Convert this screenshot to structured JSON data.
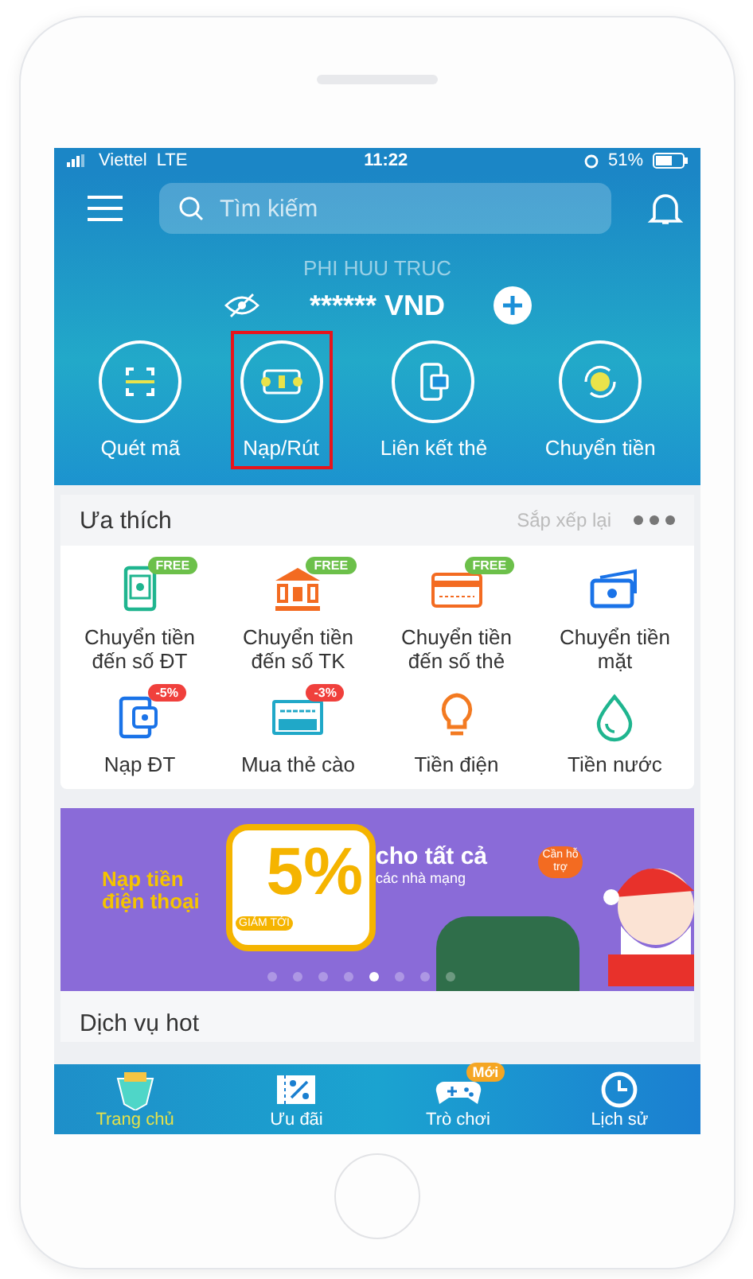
{
  "status_bar": {
    "carrier": "Viettel",
    "network": "LTE",
    "time": "11:22",
    "battery": "51%"
  },
  "header": {
    "search": {
      "placeholder": "Tìm kiếm"
    },
    "account_name": "PHI HUU TRUC",
    "balance": "****** VND"
  },
  "actions": [
    {
      "kind": "scan",
      "label": "Quét mã",
      "highlighted": false
    },
    {
      "kind": "topup",
      "label": "Nạp/Rút",
      "highlighted": true
    },
    {
      "kind": "link",
      "label": "Liên kết thẻ",
      "highlighted": false
    },
    {
      "kind": "transfer",
      "label": "Chuyển tiền",
      "highlighted": false
    }
  ],
  "favorites": {
    "title": "Ưa thích",
    "rearrange": "Sắp xếp lại",
    "items": [
      {
        "kind": "phone",
        "label": "Chuyển tiền đến số ĐT",
        "badge": "FREE",
        "color": "#6cc04a"
      },
      {
        "kind": "bank",
        "label": "Chuyển tiền đến số TK",
        "badge": "FREE",
        "color": "#6cc04a"
      },
      {
        "kind": "card",
        "label": "Chuyển tiền đến số thẻ",
        "badge": "FREE",
        "color": "#6cc04a"
      },
      {
        "kind": "cash",
        "label": "Chuyển tiền mặt"
      },
      {
        "kind": "topup",
        "label": "Nạp ĐT",
        "badge": "-5%",
        "color": "#f0403c"
      },
      {
        "kind": "voucher",
        "label": "Mua thẻ cào",
        "badge": "-3%",
        "color": "#f0403c"
      },
      {
        "kind": "bulb",
        "label": "Tiền điện"
      },
      {
        "kind": "drop",
        "label": "Tiền nước"
      }
    ]
  },
  "banner": {
    "headline": "Nạp tiền điện thoại",
    "tag": "GIẢM TỚI",
    "discount": "5%",
    "line1": "cho tất cả",
    "line2": "các nhà mạng",
    "bubble": "Cần hỗ trợ",
    "slides": [
      {
        "selected": false
      },
      {
        "selected": false
      },
      {
        "selected": false
      },
      {
        "selected": false
      },
      {
        "selected": true
      },
      {
        "selected": false
      },
      {
        "selected": false
      },
      {
        "selected": false
      }
    ]
  },
  "hot_services": {
    "title": "Dịch vụ hot"
  },
  "tabs": [
    {
      "kind": "home",
      "label": "Trang chủ",
      "selected": true
    },
    {
      "kind": "deals",
      "label": "Ưu đãi",
      "selected": false
    },
    {
      "kind": "games",
      "label": "Trò chơi",
      "selected": false,
      "badge": "Mới"
    },
    {
      "kind": "history",
      "label": "Lịch sử",
      "selected": false
    }
  ]
}
